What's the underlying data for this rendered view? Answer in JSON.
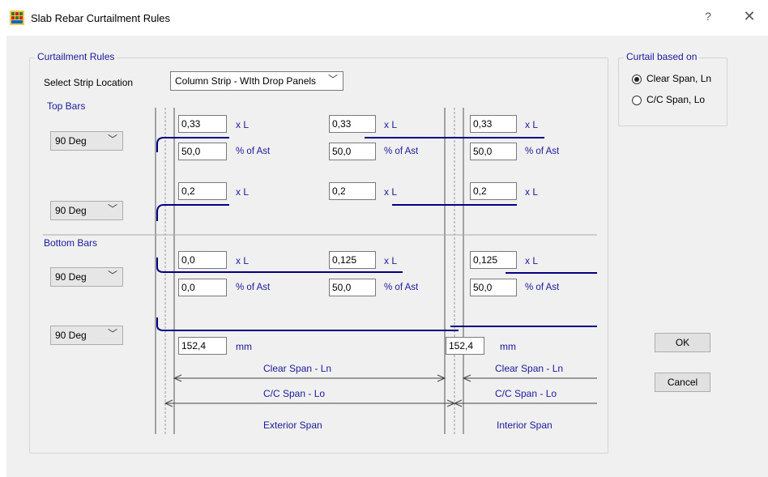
{
  "window": {
    "title": "Slab Rebar Curtailment Rules",
    "help": "?",
    "close": "✕"
  },
  "rules": {
    "legend": "Curtailment Rules",
    "strip_label": "Select Strip Location",
    "strip_value": "Column Strip - WIth Drop Panels",
    "top_bars_label": "Top Bars",
    "bottom_bars_label": "Bottom Bars",
    "hook_values": [
      "90 Deg",
      "90 Deg",
      "90 Deg",
      "90 Deg"
    ],
    "top_row1": [
      "0,33",
      "0,33",
      "0,33"
    ],
    "top_row2": [
      "50,0",
      "50,0",
      "50,0"
    ],
    "top_row3": [
      "0,2",
      "0,2",
      "0,2"
    ],
    "bottom_row1": [
      "0,0",
      "0,125",
      "0,125"
    ],
    "bottom_row2": [
      "0,0",
      "50,0",
      "50,0"
    ],
    "dims": [
      "152,4",
      "152,4"
    ],
    "unit_xl": "x L",
    "unit_ast": "% of Ast",
    "unit_mm": "mm",
    "clear_span": "Clear Span - Ln",
    "cc_span": "C/C Span - Lo",
    "exterior_span": "Exterior Span",
    "interior_span": "Interior Span"
  },
  "curtail": {
    "legend": "Curtail based on",
    "options": [
      "Clear Span, Ln",
      "C/C Span, Lo"
    ],
    "selected": 0
  },
  "buttons": {
    "ok": "OK",
    "cancel": "Cancel"
  },
  "colors": {
    "rebar": "#000080",
    "dim_line": "#444444"
  }
}
